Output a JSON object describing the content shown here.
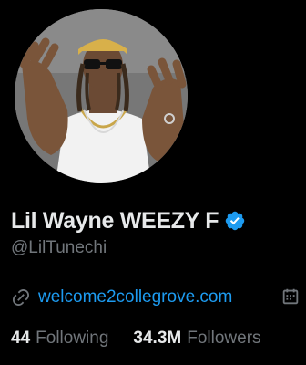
{
  "profile": {
    "display_name": "Lil Wayne WEEZY F",
    "handle": "@LilTunechi",
    "website": "welcome2collegrove.com"
  },
  "stats": {
    "following_count": "44",
    "following_label": "Following",
    "followers_count": "34.3M",
    "followers_label": "Followers"
  },
  "icons": {
    "verified": "verified-badge-icon",
    "link": "link-icon",
    "calendar": "calendar-icon"
  },
  "colors": {
    "background": "#000000",
    "primary_text": "#e7e9ea",
    "secondary_text": "#71767b",
    "link": "#1d9bf0",
    "verified": "#1d9bf0"
  }
}
